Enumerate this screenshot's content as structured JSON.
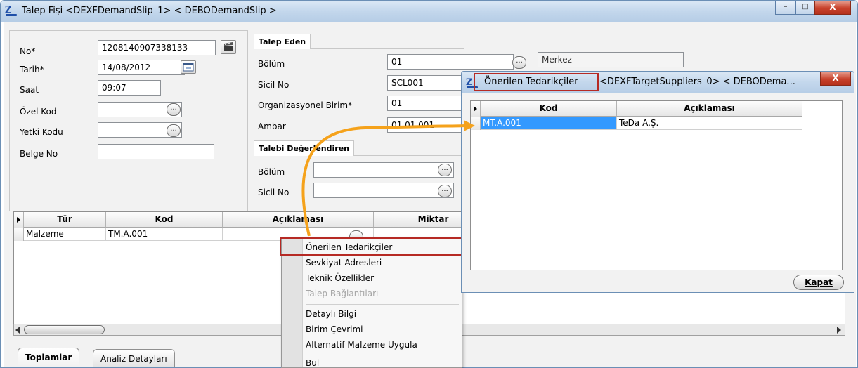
{
  "main_window": {
    "title": "Talep Fişi <DEXFDemandSlip_1> < DEBODemandSlip >",
    "controls": {
      "minimize": "–",
      "maximize": "□",
      "close": "X"
    }
  },
  "header_fields": {
    "no_label": "No*",
    "no_value": "1208140907338133",
    "tarih_label": "Tarih*",
    "tarih_value": "14/08/2012",
    "saat_label": "Saat",
    "saat_value": "09:07",
    "ozel_kod_label": "Özel Kod",
    "ozel_kod_value": "",
    "yetki_kodu_label": "Yetki Kodu",
    "yetki_kodu_value": "",
    "belge_no_label": "Belge No",
    "belge_no_value": ""
  },
  "talep_eden": {
    "title": "Talep Eden",
    "bolum_label": "Bölüm",
    "bolum_value": "01",
    "bolum_desc": "Merkez",
    "sicil_label": "Sicil No",
    "sicil_value": "SCL001",
    "org_label": "Organizasyonel Birim*",
    "org_value": "01",
    "ambar_label": "Ambar",
    "ambar_value": "01.01.001"
  },
  "talebi_degerlendiren": {
    "title": "Talebi Değerlendiren",
    "bolum_label": "Bölüm",
    "bolum_value": "",
    "sicil_label": "Sicil No",
    "sicil_value": ""
  },
  "lines_grid": {
    "columns": [
      "Tür",
      "Kod",
      "Açıklaması",
      "Miktar"
    ],
    "rows": [
      {
        "tur": "Malzeme",
        "kod": "TM.A.001",
        "aciklama": "",
        "miktar": ""
      }
    ]
  },
  "context_menu": {
    "items": [
      {
        "label": "Önerilen Tedarikçiler",
        "enabled": true
      },
      {
        "label": "Sevkiyat Adresleri",
        "enabled": true
      },
      {
        "label": "Teknik Özellikler",
        "enabled": true
      },
      {
        "label": "Talep Bağlantıları",
        "enabled": false
      },
      {
        "label": "Detaylı Bilgi",
        "enabled": true
      },
      {
        "label": "Birim Çevrimi",
        "enabled": true
      },
      {
        "label": "Alternatif Malzeme Uygula",
        "enabled": true
      },
      {
        "label": "Bul",
        "enabled": true
      }
    ]
  },
  "bottom_tabs": [
    "Toplamlar",
    "Analiz Detayları"
  ],
  "supplier_window": {
    "title_highlight": "Önerilen Tedarikçiler",
    "title_rest": "<DEXFTargetSuppliers_0> < DEBODema...",
    "close": "X",
    "columns": [
      "Kod",
      "Açıklaması"
    ],
    "rows": [
      {
        "kod": "MT.A.001",
        "aciklama": "TeDa A.Ş."
      }
    ],
    "close_button_label": "Kapat"
  },
  "colors": {
    "highlight_red": "#b62a24",
    "arrow_orange": "#f5a21b",
    "selection_blue": "#3399ff",
    "title_bar": "#c3d7ec"
  },
  "icons": {
    "app": "app-logo-icon",
    "calendar": "calendar-icon",
    "no_generator": "clapper-icon",
    "lookup": "ellipsis-icon"
  }
}
